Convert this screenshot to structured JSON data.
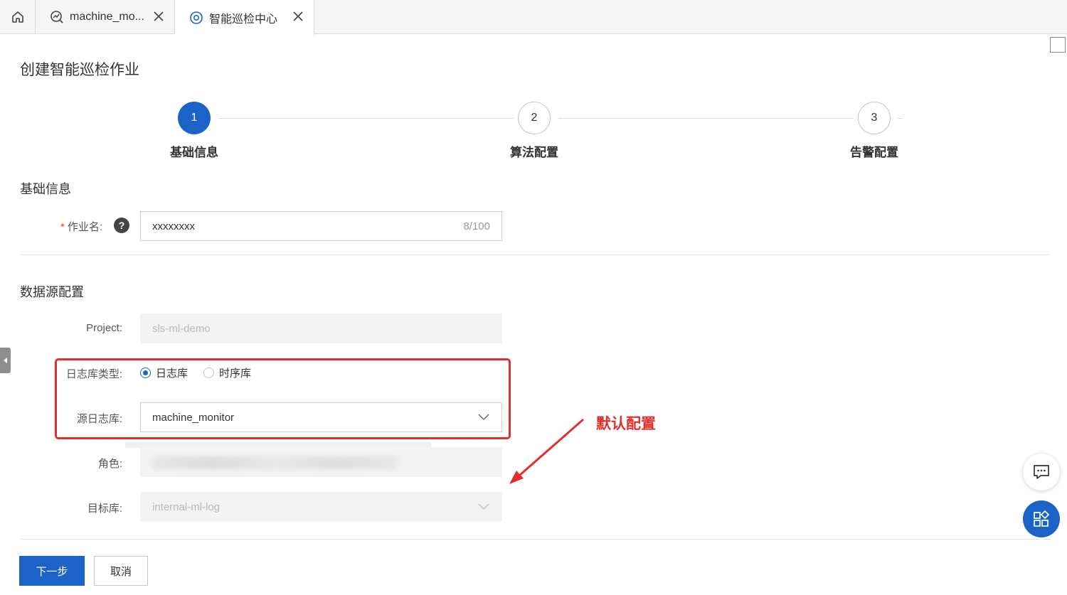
{
  "tabs": [
    {
      "label": "machine_mo...",
      "icon": "chart-icon"
    },
    {
      "label": "智能巡检中心",
      "icon": "inspection-icon",
      "active": true
    }
  ],
  "page_title": "创建智能巡检作业",
  "steps": [
    {
      "number": "1",
      "label": "基础信息",
      "active": true
    },
    {
      "number": "2",
      "label": "算法配置",
      "active": false
    },
    {
      "number": "3",
      "label": "告警配置",
      "active": false
    }
  ],
  "basic_info": {
    "title": "基础信息",
    "job_name_label": "作业名:",
    "job_name_value": "xxxxxxxx",
    "job_name_counter": "8/100",
    "help_glyph": "?"
  },
  "datasource": {
    "title": "数据源配置",
    "project_label": "Project:",
    "project_value": "sls-ml-demo",
    "logstore_type_label": "日志库类型:",
    "logstore_type_options": [
      "日志库",
      "时序库"
    ],
    "logstore_type_selected": "日志库",
    "source_logstore_label": "源日志库:",
    "source_logstore_value": "machine_monitor",
    "role_label": "角色:",
    "target_label": "目标库:",
    "target_value": "internal-ml-log"
  },
  "annotation": "默认配置",
  "buttons": {
    "next": "下一步",
    "cancel": "取消"
  },
  "colors": {
    "primary": "#1b63c6",
    "annotation_red": "#e0302b"
  }
}
